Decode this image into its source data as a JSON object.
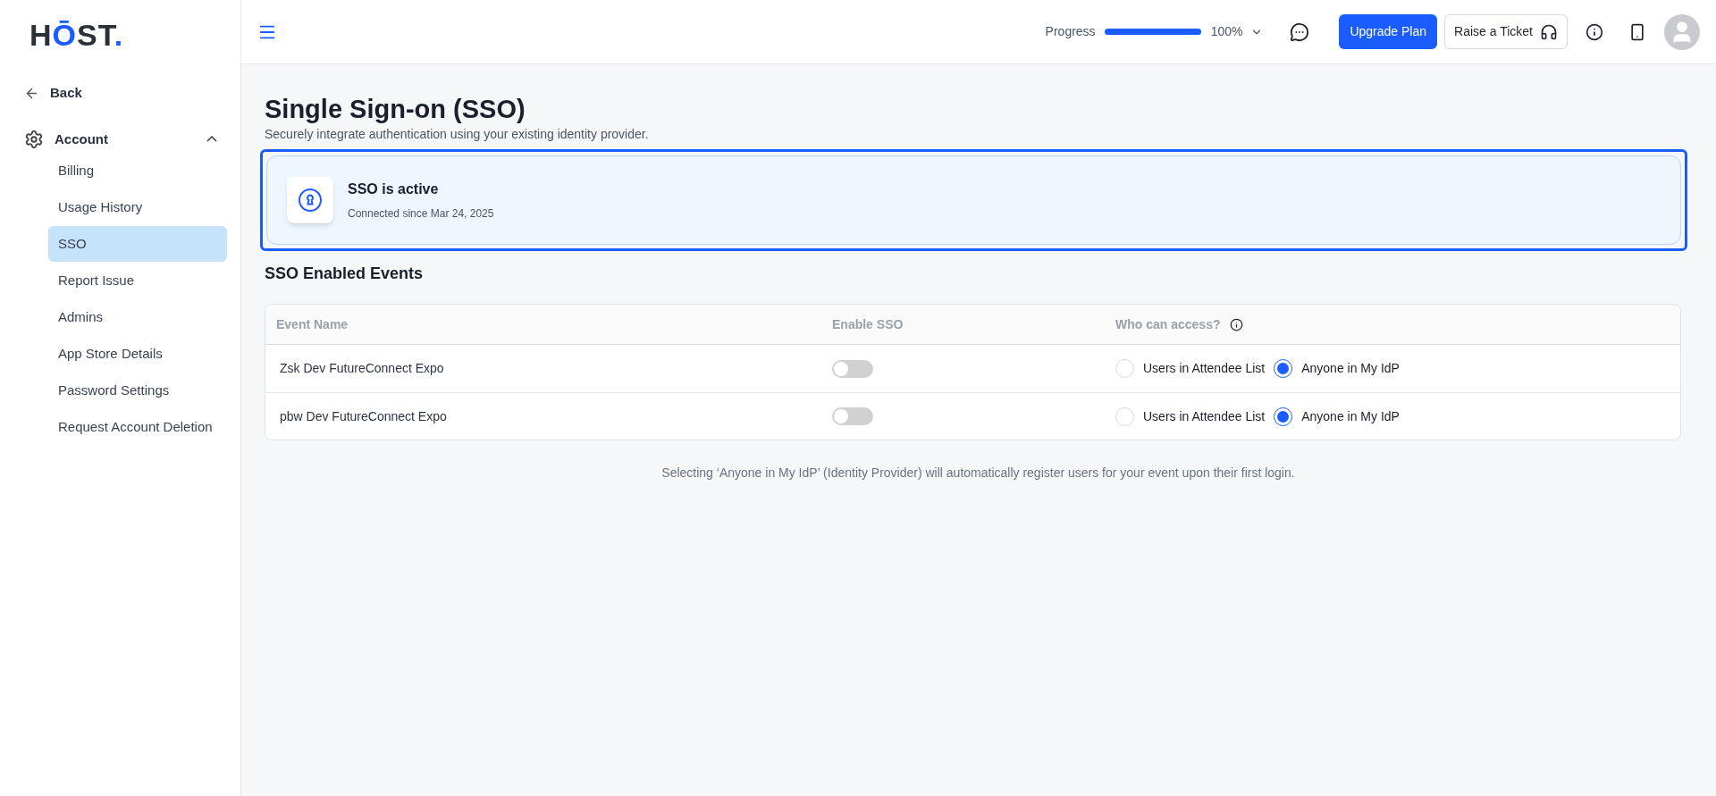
{
  "logo": [
    {
      "text": "H",
      "accent": false
    },
    {
      "text": "Ō",
      "accent": true
    },
    {
      "text": "ST",
      "accent": false
    },
    {
      "text": ".",
      "accent": true
    }
  ],
  "sidebar": {
    "back": "Back",
    "section": {
      "label": "Account",
      "expanded": true,
      "items": [
        {
          "label": "Billing",
          "selected": false
        },
        {
          "label": "Usage History",
          "selected": false
        },
        {
          "label": "SSO",
          "selected": true
        },
        {
          "label": "Report Issue",
          "selected": false
        },
        {
          "label": "Admins",
          "selected": false
        },
        {
          "label": "App Store Details",
          "selected": false
        },
        {
          "label": "Password Settings",
          "selected": false
        },
        {
          "label": "Request Account Deletion",
          "selected": false
        }
      ]
    }
  },
  "header": {
    "progress_label": "Progress",
    "level": 1,
    "progress_reading": "100%",
    "upgrade_button": "Upgrade Plan",
    "ticket_button": "Raise a Ticket"
  },
  "page": {
    "title": "Single Sign-on (SSO)",
    "subtitle": "Securely integrate authentication using your existing identity provider.",
    "status_card": {
      "title": "SSO is active",
      "detail": "Connected since Mar 24, 2025"
    },
    "section_title": "SSO Enabled Events",
    "table": {
      "columns": [
        "Event Name",
        "Enable SSO",
        "Who can access?"
      ],
      "rows": [
        {
          "event": "Zsk Dev FutureConnect Expo",
          "enabled": false,
          "options": [
            {
              "label": "Users in Attendee List",
              "selected": false
            },
            {
              "label": "Anyone in My IdP",
              "selected": true
            }
          ]
        },
        {
          "event": "pbw Dev FutureConnect Expo",
          "enabled": false,
          "options": [
            {
              "label": "Users in Attendee List",
              "selected": false
            },
            {
              "label": "Anyone in My IdP",
              "selected": true
            }
          ]
        }
      ]
    },
    "note": "Selecting ‘Anyone in My IdP’ (Identity Provider) will automatically register users for your event upon their first login."
  }
}
